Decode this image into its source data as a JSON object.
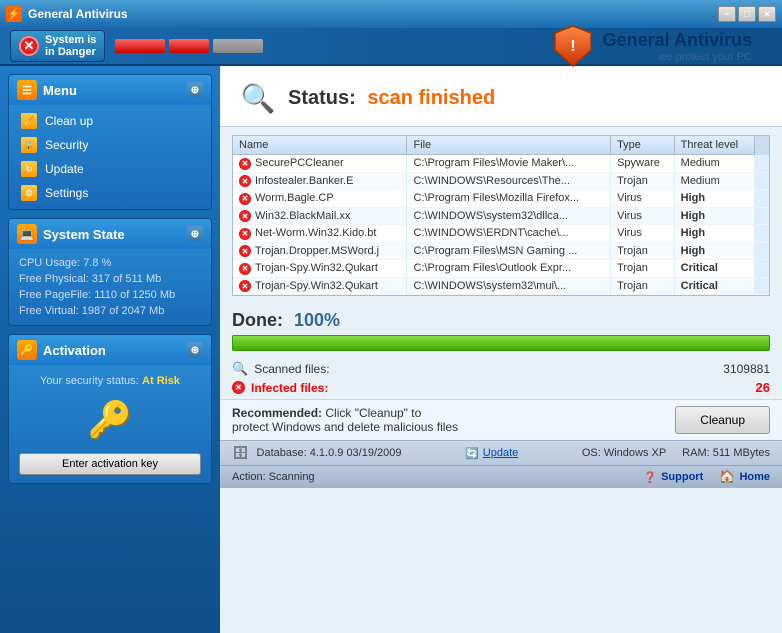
{
  "titlebar": {
    "title": "General Antivirus",
    "min": "−",
    "max": "□",
    "close": "×"
  },
  "topbar": {
    "danger_line1": "System is",
    "danger_line2": "in Danger"
  },
  "logo": {
    "title": "General Antivirus",
    "subtitle": "we protect your PC"
  },
  "menu": {
    "header": "Menu",
    "items": [
      {
        "label": "Clean up"
      },
      {
        "label": "Security"
      },
      {
        "label": "Update"
      },
      {
        "label": "Settings"
      }
    ]
  },
  "system_state": {
    "header": "System State",
    "cpu": "CPU Usage: 7.8 %",
    "free_physical": "Free Physical: 317 of 511 Mb",
    "free_pagefile": "Free PageFile: 1110 of 1250 Mb",
    "free_virtual": "Free Virtual: 1987 of 2047 Mb"
  },
  "activation": {
    "header": "Activation",
    "status_label": "Your security status:",
    "status_value": "At Risk",
    "button": "Enter activation key"
  },
  "content": {
    "status_prefix": "Status:",
    "status_value": "scan finished",
    "done_prefix": "Done:",
    "done_value": "100%",
    "scanned_label": "Scanned files:",
    "scanned_value": "3109881",
    "infected_label": "Infected files:",
    "infected_value": "26",
    "recommended_prefix": "Recommended:",
    "recommended_text": "Click \"Cleanup\" to\nprotect Windows and delete malicious files",
    "cleanup_button": "Cleanup"
  },
  "table": {
    "columns": [
      "Name",
      "File",
      "Type",
      "Threat level"
    ],
    "rows": [
      {
        "name": "SecurePCCleaner",
        "file": "C:\\Program Files\\Movie Maker\\...",
        "type": "Spyware",
        "threat": "Medium",
        "threat_class": "threat-medium"
      },
      {
        "name": "Infostealer.Banker.E",
        "file": "C:\\WINDOWS\\Resources\\The...",
        "type": "Trojan",
        "threat": "Medium",
        "threat_class": "threat-medium"
      },
      {
        "name": "Worm.Bagle.CP",
        "file": "C:\\Program Files\\Mozilla Firefox...",
        "type": "Virus",
        "threat": "High",
        "threat_class": "threat-high"
      },
      {
        "name": "Win32.BlackMail.xx",
        "file": "C:\\WINDOWS\\system32\\dllca...",
        "type": "Virus",
        "threat": "High",
        "threat_class": "threat-high"
      },
      {
        "name": "Net-Worm.Win32.Kido.bt",
        "file": "C:\\WINDOWS\\ERDNT\\cache\\...",
        "type": "Virus",
        "threat": "High",
        "threat_class": "threat-high"
      },
      {
        "name": "Trojan.Dropper.MSWord.j",
        "file": "C:\\Program Files\\MSN Gaming ...",
        "type": "Trojan",
        "threat": "High",
        "threat_class": "threat-high"
      },
      {
        "name": "Trojan-Spy.Win32.Qukart",
        "file": "C:\\Program Files\\Outlook Expr...",
        "type": "Trojan",
        "threat": "Critical",
        "threat_class": "threat-critical"
      },
      {
        "name": "Trojan-Spy.Win32.Qukart",
        "file": "C:\\WINDOWS\\system32\\mui\\...",
        "type": "Trojan",
        "threat": "Critical",
        "threat_class": "threat-critical"
      }
    ]
  },
  "bottombar": {
    "db_label": "Database:",
    "db_version": "4.1.0.9",
    "db_date": "03/19/2009",
    "update_label": "Update",
    "os_label": "OS: Windows XP",
    "ram_label": "RAM: 511 MBytes"
  },
  "actionbar": {
    "action_label": "Action: Scanning",
    "support_label": "Support",
    "home_label": "Home"
  }
}
